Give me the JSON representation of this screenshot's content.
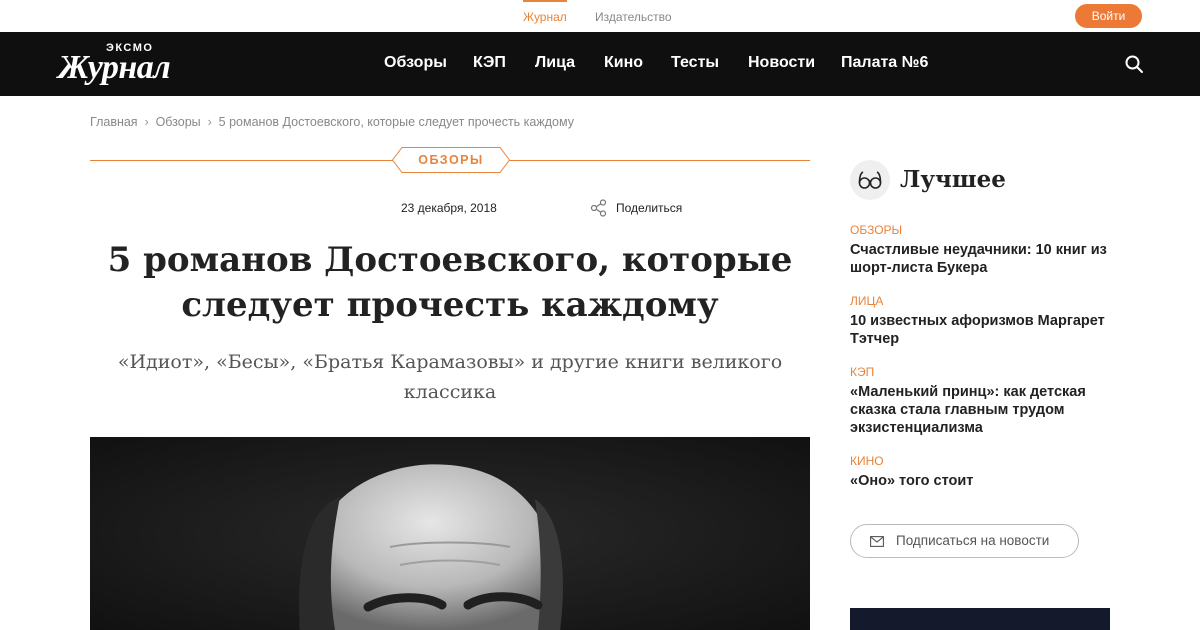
{
  "topbar": {
    "tabs": [
      {
        "label": "Журнал",
        "active": true
      },
      {
        "label": "Издательство",
        "active": false
      }
    ],
    "login_label": "Войти"
  },
  "logo": {
    "small": "ЭКСМО",
    "big": "Журнал"
  },
  "nav": {
    "items": [
      "Обзоры",
      "КЭП",
      "Лица",
      "Кино",
      "Тесты",
      "Новости",
      "Палата №6"
    ],
    "search_icon": "search-icon"
  },
  "breadcrumbs": [
    "Главная",
    "Обзоры",
    "5 романов Достоевского, которые следует прочесть каждому"
  ],
  "article": {
    "category": "ОБЗОРЫ",
    "date": "23 декабря, 2018",
    "share_label": "Поделиться",
    "title_lines": [
      "5 романов Достоевского, которые",
      "следует прочесть каждому"
    ],
    "subtitle_lines": [
      "«Идиот», «Бесы», «Братья Карамазовы» и другие книги великого",
      "классика"
    ]
  },
  "sidebar": {
    "title": "Лучшее",
    "icon": "glasses-icon",
    "items": [
      {
        "category": "Обзоры",
        "title": "Счастливые неудачники: 10 книг из шорт-листа Букера"
      },
      {
        "category": "Лица",
        "title": "10 известных афоризмов Маргарет Тэтчер"
      },
      {
        "category": "КЭП",
        "title": "«Маленький принц»: как детская сказка стала главным трудом экзистенциализма"
      },
      {
        "category": "Кино",
        "title": "«Оно» того стоит"
      }
    ],
    "subscribe_label": "Подписаться на новости"
  },
  "colors": {
    "accent": "#e8833a",
    "nav_bg": "#0f0f0f"
  }
}
